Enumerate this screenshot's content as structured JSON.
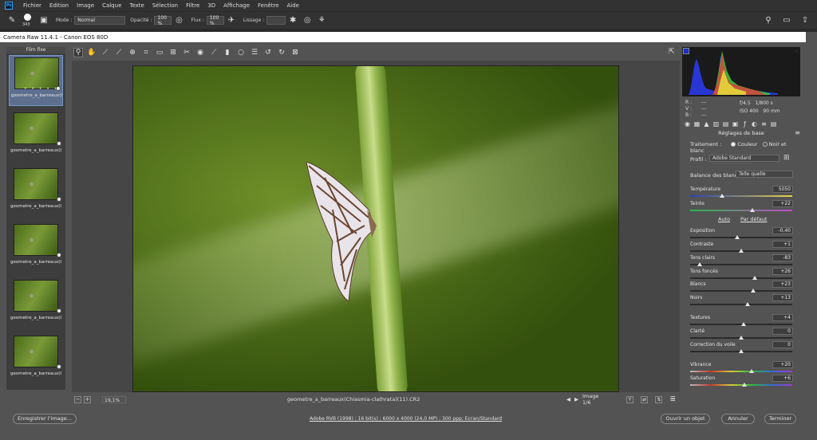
{
  "menubar": {
    "items": [
      "Fichier",
      "Edition",
      "Image",
      "Calque",
      "Texte",
      "Sélection",
      "Filtre",
      "3D",
      "Affichage",
      "Fenêtre",
      "Aide"
    ]
  },
  "options": {
    "brush_size": "343",
    "mode_label": "Mode :",
    "mode_value": "Normal",
    "opacity_label": "Opacité :",
    "opacity_value": "100 %",
    "flow_label": "Flux :",
    "flow_value": "100 %",
    "smoothing_label": "Lissage :",
    "smoothing_value": ""
  },
  "dialog": {
    "title": "Camera Raw 11.4.1  -  Canon EOS 80D",
    "filmstrip_header": "Film fixe",
    "thumbnails": [
      {
        "name": "geometre_a_barreaux(Chi...",
        "selected": true
      },
      {
        "name": "geometre_a_barreaux(Chi...",
        "selected": false
      },
      {
        "name": "geometre_a_barreaux(Chi...",
        "selected": false
      },
      {
        "name": "geometre_a_barreaux(Chi...",
        "selected": false
      },
      {
        "name": "geometre_a_barreaux(Chi...",
        "selected": false
      },
      {
        "name": "geometre_a_barreaux(Chi...",
        "selected": false
      }
    ],
    "thumb_rating": "• • • • •",
    "zoom_value": "19,1%",
    "filename": "geometre_a_barreaux(Chiasmia-clathrata)(11).CR2",
    "image_counter": "Image 1/6",
    "y_button": "Y"
  },
  "info": {
    "r_label": "R :",
    "r_value": "---",
    "v_label": "V :",
    "v_value": "---",
    "b_label": "B :",
    "b_value": "---",
    "aperture": "f/4,5",
    "shutter": "1/800 s",
    "iso": "ISO 400",
    "focal": "90 mm"
  },
  "panel": {
    "title": "Réglages de base",
    "treatment_label": "Traitement :",
    "treatment_color": "Couleur",
    "treatment_bw": "Noir et blanc",
    "treatment_selected": "Couleur",
    "profile_label": "Profil :",
    "profile_value": "Adobe Standard",
    "wb_label": "Balance des blancs :",
    "wb_value": "Telle quelle",
    "auto_label": "Auto",
    "default_label": "Par défaut",
    "sliders": [
      {
        "label": "Température",
        "value": "5050",
        "pos": 0.31,
        "kind": "temp"
      },
      {
        "label": "Teinte",
        "value": "+22",
        "pos": 0.61,
        "kind": "tint"
      },
      {
        "label": "Exposition",
        "value": "-0,40",
        "pos": 0.46,
        "kind": "plain"
      },
      {
        "label": "Contraste",
        "value": "+1",
        "pos": 0.5,
        "kind": "plain"
      },
      {
        "label": "Tons clairs",
        "value": "-83",
        "pos": 0.09,
        "kind": "plain"
      },
      {
        "label": "Tons foncés",
        "value": "+26",
        "pos": 0.63,
        "kind": "plain"
      },
      {
        "label": "Blancs",
        "value": "+23",
        "pos": 0.62,
        "kind": "plain"
      },
      {
        "label": "Noirs",
        "value": "+13",
        "pos": 0.56,
        "kind": "plain"
      },
      {
        "label": "Textures",
        "value": "+4",
        "pos": 0.52,
        "kind": "plain"
      },
      {
        "label": "Clarté",
        "value": "0",
        "pos": 0.5,
        "kind": "plain"
      },
      {
        "label": "Correction du voile",
        "value": "0",
        "pos": 0.5,
        "kind": "plain"
      },
      {
        "label": "Vibrance",
        "value": "+20",
        "pos": 0.6,
        "kind": "sat"
      },
      {
        "label": "Saturation",
        "value": "+6",
        "pos": 0.53,
        "kind": "sat"
      }
    ]
  },
  "bottom": {
    "save_label": "Enregistrer l'image...",
    "workflow": "Adobe RVB (1998) ; 16 bit(s) ; 6000 x 4000 (24,0 MP) ; 300 ppp; Ecran/Standard",
    "open_label": "Ouvrir un objet",
    "cancel_label": "Annuler",
    "done_label": "Terminer"
  }
}
